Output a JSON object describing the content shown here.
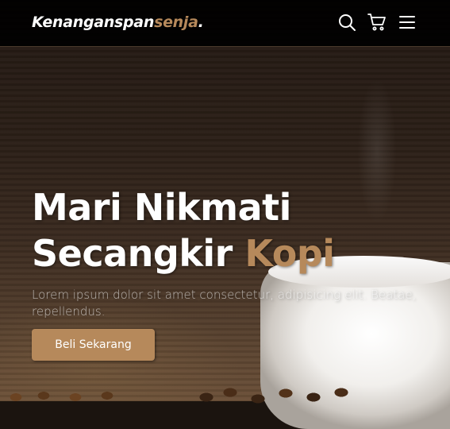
{
  "brand": {
    "name_main": "Kenanganspan",
    "name_accent": "senja",
    "name_dot": "."
  },
  "hero": {
    "title_line1": "Mari Nikmati",
    "title_line2_main": "Secangkir ",
    "title_line2_accent": "Kopi",
    "description": "Lorem ipsum dolor sit amet consectetur, adipisicing elit. Beatae, repellendus.",
    "cta_label": "Beli Sekarang"
  },
  "icons": [
    "search-icon",
    "shopping-cart-icon",
    "menu-icon"
  ],
  "colors": {
    "accent": "#b6895b",
    "navbar_bg": "#000000",
    "text": "#ffffff"
  }
}
